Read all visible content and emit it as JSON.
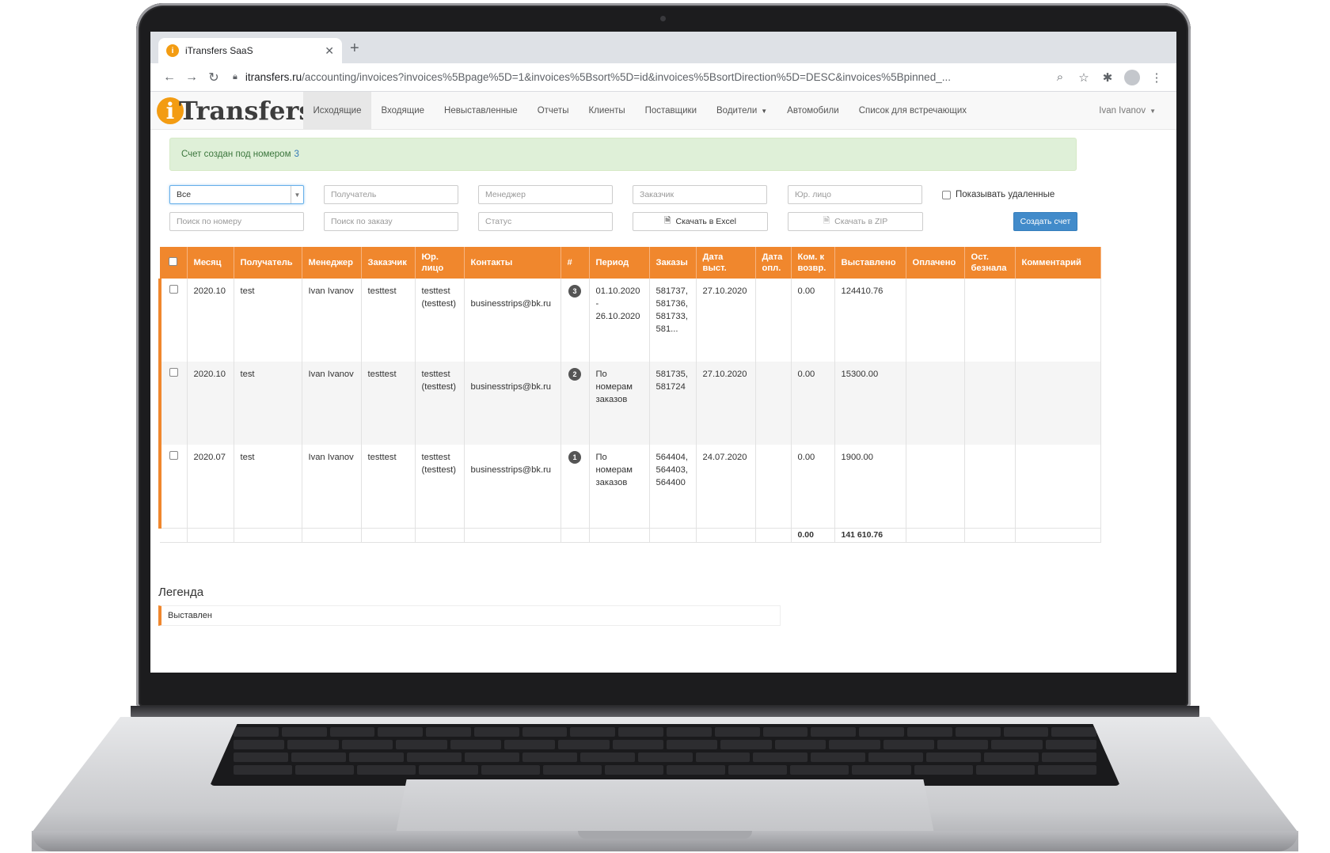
{
  "browser": {
    "tab_title": "iTransfers SaaS",
    "tab_close": "✕",
    "new_tab": "+",
    "url_host": "itransfers.ru",
    "url_path": "/accounting/invoices?invoices%5Bpage%5D=1&invoices%5Bsort%5D=id&invoices%5BsortDirection%5D=DESC&invoices%5Bpinned_..."
  },
  "logo": {
    "mark": "i",
    "text": "Transfers"
  },
  "nav": {
    "items": [
      {
        "label": "Исходящие"
      },
      {
        "label": "Входящие"
      },
      {
        "label": "Невыставленные"
      },
      {
        "label": "Отчеты"
      },
      {
        "label": "Клиенты"
      },
      {
        "label": "Поставщики"
      },
      {
        "label": "Водители"
      },
      {
        "label": "Автомобили"
      },
      {
        "label": "Список для встречающих"
      }
    ],
    "user": "Ivan Ivanov"
  },
  "alert": {
    "text": "Счет создан под номером",
    "number": "3"
  },
  "filters": {
    "status_select": "Все",
    "recipient_placeholder": "Получатель",
    "manager_placeholder": "Менеджер",
    "customer_placeholder": "Заказчик",
    "legal_entity_placeholder": "Юр. лицо",
    "show_deleted": "Показывать удаленные",
    "search_number_placeholder": "Поиск по номеру",
    "search_order_placeholder": "Поиск по заказу",
    "status_placeholder": "Статус",
    "excel_button": "Скачать в Excel",
    "zip_button": "Скачать в ZIP",
    "create_button": "Создать счет"
  },
  "table": {
    "headers": {
      "month": "Месяц",
      "recipient": "Получатель",
      "manager": "Менеджер",
      "customer": "Заказчик",
      "legal_entity": "Юр. лицо",
      "contacts": "Контакты",
      "number": "#",
      "period": "Период",
      "orders": "Заказы",
      "issue_date": "Дата выст.",
      "pay_date": "Дата опл.",
      "refund_fee": "Ком. к возвр.",
      "invoiced": "Выставлено",
      "paid": "Оплачено",
      "cashless_balance": "Ост. безнала",
      "comment": "Комментарий"
    },
    "rows": [
      {
        "month": "2020.10",
        "recipient": "test",
        "manager": "Ivan Ivanov",
        "customer": "testtest",
        "legal_entity": "testtest (testtest)",
        "contacts": "businesstrips@bk.ru",
        "number": "3",
        "period": "01.10.2020 - 26.10.2020",
        "orders": "581737, 581736, 581733, 581...",
        "issue_date": "27.10.2020",
        "pay_date": "",
        "refund_fee": "0.00",
        "invoiced": "124410.76",
        "paid": "",
        "cashless_balance": "",
        "comment": ""
      },
      {
        "month": "2020.10",
        "recipient": "test",
        "manager": "Ivan Ivanov",
        "customer": "testtest",
        "legal_entity": "testtest (testtest)",
        "contacts": "businesstrips@bk.ru",
        "number": "2",
        "period": "По номерам заказов",
        "orders": "581735, 581724",
        "issue_date": "27.10.2020",
        "pay_date": "",
        "refund_fee": "0.00",
        "invoiced": "15300.00",
        "paid": "",
        "cashless_balance": "",
        "comment": ""
      },
      {
        "month": "2020.07",
        "recipient": "test",
        "manager": "Ivan Ivanov",
        "customer": "testtest",
        "legal_entity": "testtest (testtest)",
        "contacts": "businesstrips@bk.ru",
        "number": "1",
        "period": "По номерам заказов",
        "orders": "564404, 564403, 564400",
        "issue_date": "24.07.2020",
        "pay_date": "",
        "refund_fee": "0.00",
        "invoiced": "1900.00",
        "paid": "",
        "cashless_balance": "",
        "comment": ""
      }
    ],
    "totals": {
      "refund_fee": "0.00",
      "invoiced": "141 610.76"
    }
  },
  "legend": {
    "title": "Легенда",
    "item": "Выставлен"
  },
  "colors": {
    "accent": "#f0872d",
    "primary_button": "#428bca",
    "alert_bg": "#dff0d8"
  }
}
